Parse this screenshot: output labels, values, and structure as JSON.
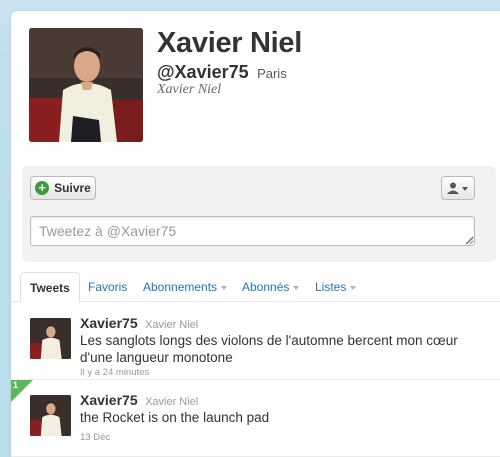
{
  "profile": {
    "name": "Xavier Niel",
    "handle": "@Xavier75",
    "location": "Paris",
    "real_name": "Xavier Niel"
  },
  "actions": {
    "follow_label": "Suivre",
    "follow_icon": "plus-circle-icon",
    "user_menu_icon": "user-dropdown-icon",
    "tweet_placeholder": "Tweetez à @Xavier75"
  },
  "tabs": [
    {
      "label": "Tweets",
      "active": true
    },
    {
      "label": "Favoris"
    },
    {
      "label": "Abonnements"
    },
    {
      "label": "Abonnés"
    },
    {
      "label": "Listes"
    }
  ],
  "tweets": [
    {
      "user": "Xavier75",
      "name": "Xavier Niel",
      "text": "Les sanglots longs des violons de l'automne bercent mon cœur d'une langueur monotone",
      "time": "Il y a 24 minutes"
    },
    {
      "user": "Xavier75",
      "name": "Xavier Niel",
      "text": "the Rocket is on the launch pad",
      "time": "13 Déc",
      "badge": "1"
    }
  ],
  "colors": {
    "background": "#c0deed",
    "link": "#2276bb",
    "follow_green": "#3e9b3e"
  }
}
